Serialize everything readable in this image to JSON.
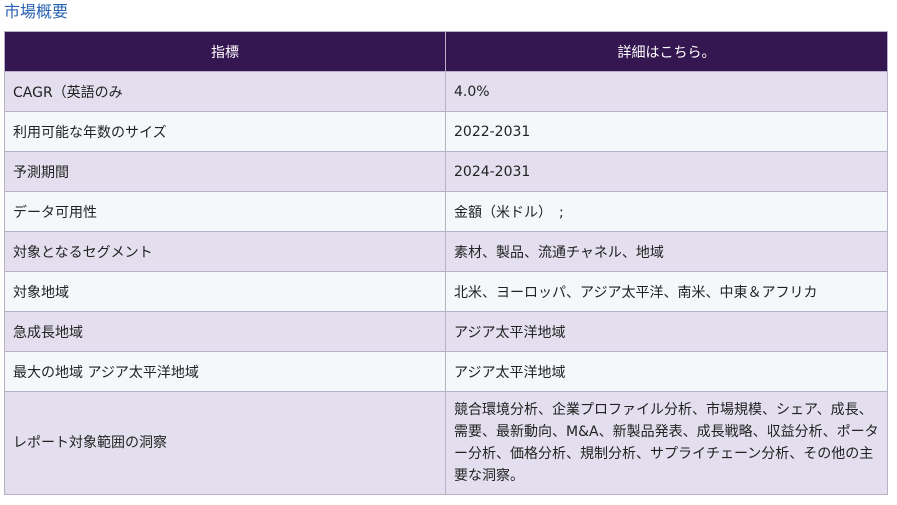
{
  "section_title": "市場概要",
  "table": {
    "headers": [
      "指標",
      "詳細はこちら。"
    ],
    "rows": [
      {
        "metric": "CAGR（英語のみ",
        "detail": "4.0%"
      },
      {
        "metric": "利用可能な年数のサイズ",
        "detail": "2022-2031"
      },
      {
        "metric": "予測期間",
        "detail": "2024-2031"
      },
      {
        "metric": "データ可用性",
        "detail": "金額（米ドル）　;"
      },
      {
        "metric": "対象となるセグメント",
        "detail": "素材、製品、流通チャネル、地域"
      },
      {
        "metric": "対象地域",
        "detail": "北米、ヨーロッパ、アジア太平洋、南米、中東＆アフリカ"
      },
      {
        "metric": "急成長地域",
        "detail": "アジア太平洋地域"
      },
      {
        "metric": "最大の地域 アジア太平洋地域",
        "detail": "アジア太平洋地域"
      },
      {
        "metric": "レポート対象範囲の洞察",
        "detail": "競合環境分析、企業プロファイル分析、市場規模、シェア、成長、需要、最新動向、M&A、新製品発表、成長戦略、収益分析、ポーター分析、価格分析、規制分析、サプライチェーン分析、その他の主要な洞察。"
      }
    ]
  }
}
